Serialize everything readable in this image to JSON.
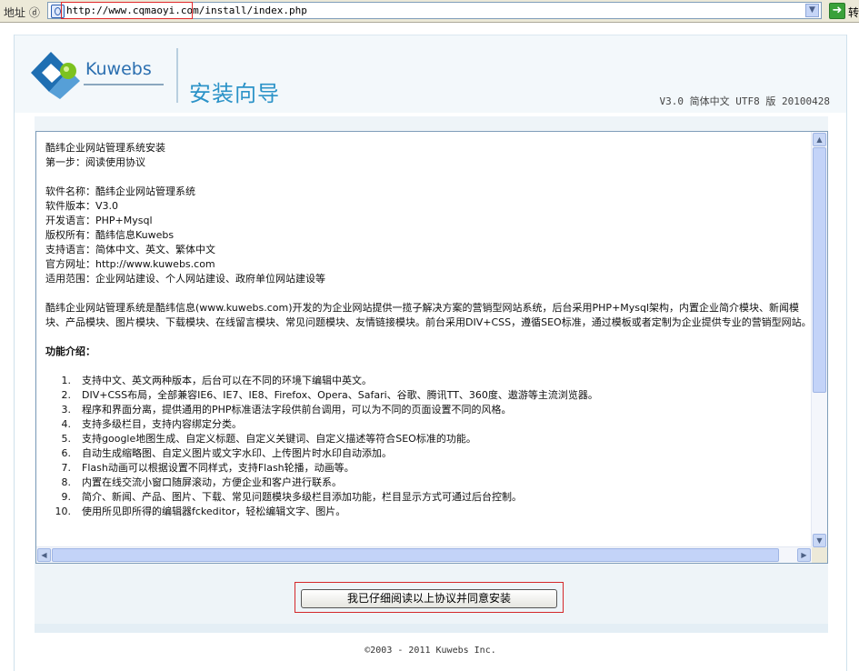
{
  "address_bar": {
    "label": "地址 ⓓ",
    "url": "http://www.cqmaoyi.com/install/index.php",
    "go_label": "转"
  },
  "header": {
    "brand": "Kuwebs",
    "title": "安装向导",
    "version": "V3.0 简体中文 UTF8 版 20100428",
    "brand_colors": {
      "primary": "#2b6fb0",
      "accent": "#7cc21f",
      "title": "#2c93c8"
    }
  },
  "agreement": {
    "intro_lines": [
      "酷纬企业网站管理系统安装",
      "第一步：阅读使用协议"
    ],
    "info_lines": [
      "软件名称：酷纬企业网站管理系统",
      "软件版本：V3.0",
      "开发语言：PHP+Mysql",
      "版权所有：酷纬信息Kuwebs",
      "支持语言：简体中文、英文、繁体中文",
      "官方网址：http://www.kuwebs.com",
      "适用范围：企业网站建设、个人网站建设、政府单位网站建设等"
    ],
    "description": "酷纬企业网站管理系统是酷纬信息(www.kuwebs.com)开发的为企业网站提供一揽子解决方案的营销型网站系统，后台采用PHP+Mysql架构，内置企业简介模块、新闻模块、产品模块、图片模块、下载模块、在线留言模块、常见问题模块、友情链接模块。前台采用DIV+CSS，遵循SEO标准，通过模板或者定制为企业提供专业的营销型网站。",
    "features_heading": "功能介绍：",
    "features": [
      {
        "num": "1.",
        "text": "支持中文、英文两种版本，后台可以在不同的环境下编辑中英文。"
      },
      {
        "num": "2.",
        "text": "DIV+CSS布局，全部兼容IE6、IE7、IE8、Firefox、Opera、Safari、谷歌、腾讯TT、360度、遨游等主流浏览器。"
      },
      {
        "num": "3.",
        "text": "程序和界面分离，提供通用的PHP标准语法字段供前台调用，可以为不同的页面设置不同的风格。"
      },
      {
        "num": "4.",
        "text": "支持多级栏目，支持内容绑定分类。"
      },
      {
        "num": "5.",
        "text": "支持google地图生成、自定义标题、自定义关键词、自定义描述等符合SEO标准的功能。"
      },
      {
        "num": "6.",
        "text": "自动生成缩略图、自定义图片或文字水印、上传图片时水印自动添加。"
      },
      {
        "num": "7.",
        "text": "Flash动画可以根据设置不同样式，支持Flash轮播，动画等。"
      },
      {
        "num": "8.",
        "text": "内置在线交流小窗口随屏滚动，方便企业和客户进行联系。"
      },
      {
        "num": "9.",
        "text": "简介、新闻、产品、图片、下载、常见问题模块多级栏目添加功能，栏目显示方式可通过后台控制。"
      },
      {
        "num": "10.",
        "text": "使用所见即所得的编辑器fckeditor，轻松编辑文字、图片。"
      }
    ]
  },
  "agree_button": "我已仔细阅读以上协议并同意安装",
  "copyright": "©2003 - 2011 Kuwebs Inc."
}
